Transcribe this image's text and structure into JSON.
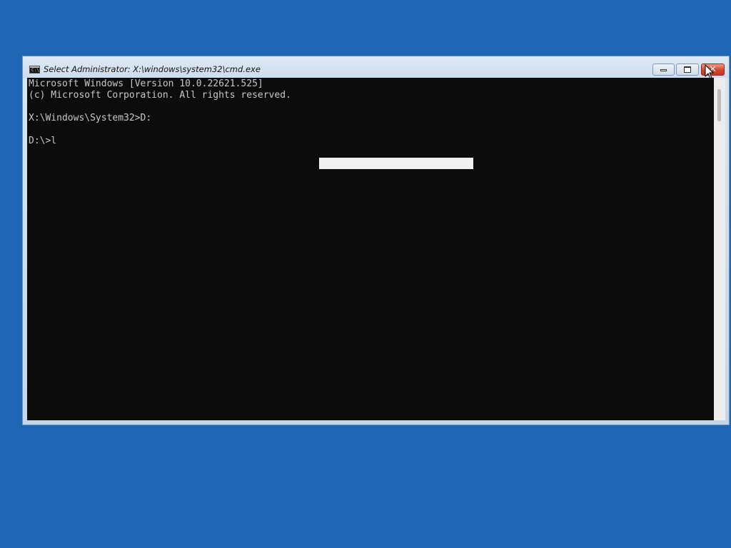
{
  "window": {
    "title": "Select Administrator: X:\\windows\\system32\\cmd.exe",
    "icon": "cmd-icon",
    "icon_label": "C:\\",
    "controls": {
      "minimize_icon": "minimize-icon",
      "maximize_icon": "maximize-icon",
      "close_icon": "close-icon",
      "close_glyph": "✕"
    }
  },
  "console": {
    "lines": [
      "Microsoft Windows [Version 10.0.22621.525]",
      "(c) Microsoft Corporation. All rights reserved.",
      "",
      "X:\\Windows\\System32>D:",
      "",
      "D:\\>l"
    ]
  },
  "colors": {
    "desktop": "#1f66b5",
    "console_bg": "#0c0c0c",
    "console_text": "#c8c8c8",
    "selection": "#f0f0f0",
    "close_button": "#d2462c"
  }
}
